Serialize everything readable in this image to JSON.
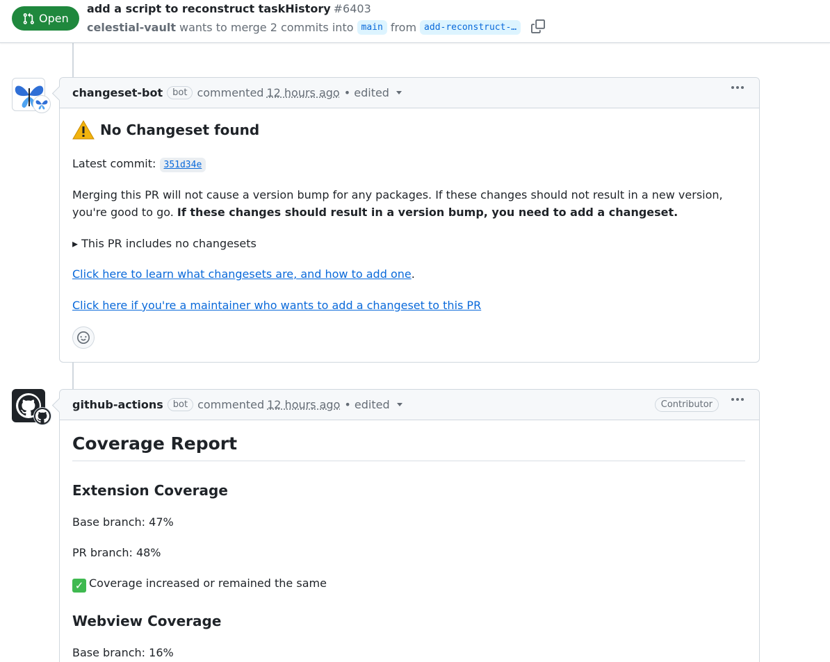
{
  "header": {
    "state": "Open",
    "title": "add a script to reconstruct taskHistory",
    "number": "#6403",
    "author": "celestial-vault",
    "merge_text": "wants to merge 2 commits into",
    "base_branch": "main",
    "from_text": "from",
    "head_branch": "add-reconstruct-…"
  },
  "comments": [
    {
      "author": "changeset-bot",
      "bot_label": "bot",
      "action": "commented",
      "time": "12 hours ago",
      "edited": "• edited",
      "heading": "No Changeset found",
      "latest_commit_label": "Latest commit:",
      "sha": "351d34e",
      "body_plain": "Merging this PR will not cause a version bump for any packages. If these changes should not result in a new version, you're good to go.",
      "body_bold": "If these changes should result in a version bump, you need to add a changeset.",
      "details_summary": "▸ This PR includes no changesets",
      "link_learn": "Click here to learn what changesets are, and how to add one",
      "link_learn_suffix": ".",
      "link_maintainer": "Click here if you're a maintainer who wants to add a changeset to this PR"
    },
    {
      "author": "github-actions",
      "bot_label": "bot",
      "action": "commented",
      "time": "12 hours ago",
      "edited": "• edited",
      "role": "Contributor",
      "report_title": "Coverage Report",
      "ext_title": "Extension Coverage",
      "ext_base": "Base branch: 47%",
      "ext_pr": "PR branch: 48%",
      "ext_status": "Coverage increased or remained the same",
      "web_title": "Webview Coverage",
      "web_base": "Base branch: 16%"
    }
  ],
  "colors": {
    "open_green": "#1f883d",
    "link_blue": "#0969da",
    "border": "#d0d7de"
  }
}
